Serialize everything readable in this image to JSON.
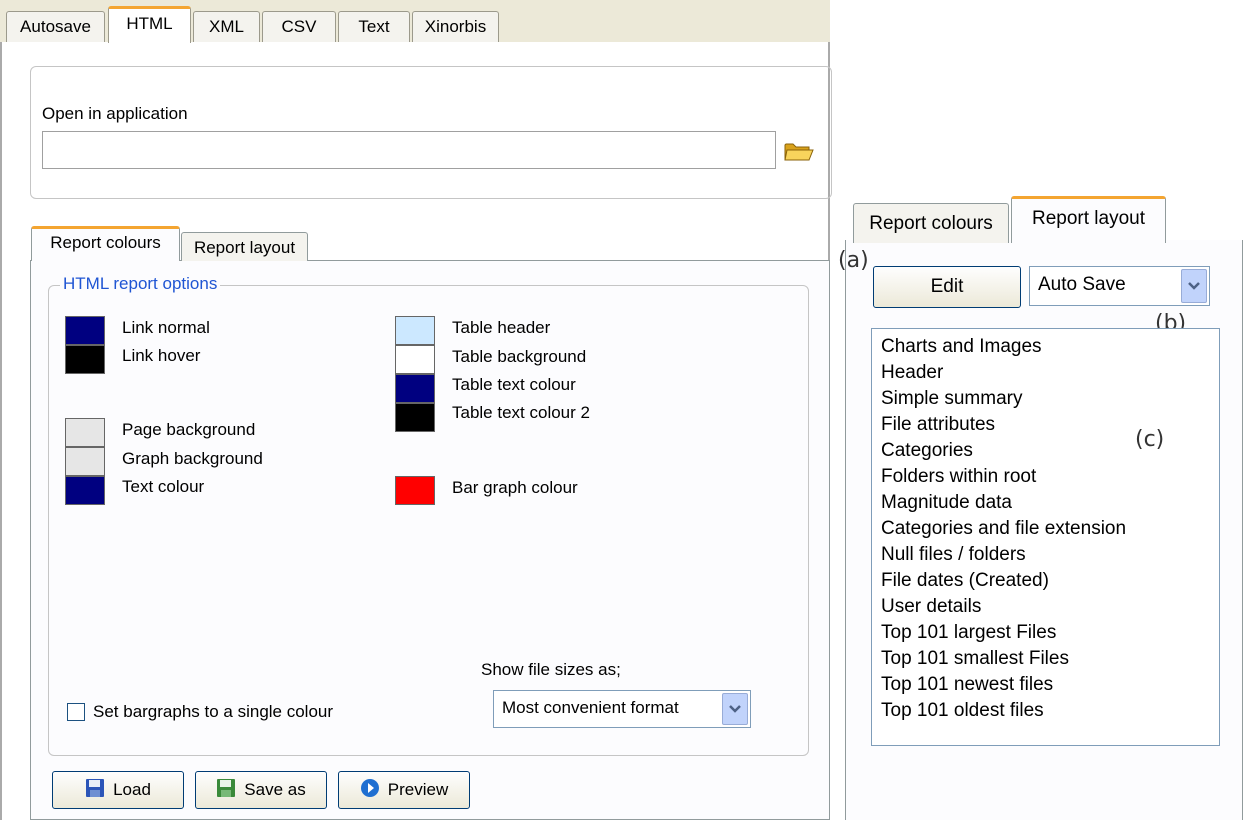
{
  "top_tabs": [
    "Autosave",
    "HTML",
    "XML",
    "CSV",
    "Text",
    "Xinorbis"
  ],
  "open_app": {
    "label": "Open in application",
    "path_value": ""
  },
  "report_tabs": [
    "Report colours",
    "Report layout"
  ],
  "options": {
    "legend": "HTML report options",
    "swatches_left": [
      {
        "label": "Link normal",
        "color": "#000080"
      },
      {
        "label": "Link hover",
        "color": "#000000"
      },
      {
        "label": "Page background",
        "color": "#e6e6e6"
      },
      {
        "label": "Graph background",
        "color": "#e6e6e6"
      },
      {
        "label": "Text colour",
        "color": "#000080"
      }
    ],
    "swatches_right": [
      {
        "label": "Table header",
        "color": "#cce8ff"
      },
      {
        "label": "Table background",
        "color": "#ffffff"
      },
      {
        "label": "Table text colour",
        "color": "#000080"
      },
      {
        "label": "Table text colour 2",
        "color": "#000000"
      },
      {
        "label": "Bar graph colour",
        "color": "#ff0000"
      }
    ],
    "single_colour_checkbox": "Set bargraphs to a single colour",
    "file_sizes_label": "Show file sizes as;",
    "file_sizes_value": "Most convenient format"
  },
  "buttons": {
    "load": "Load",
    "save_as": "Save as",
    "preview": "Preview"
  },
  "layout_panel": {
    "tabs": [
      "Report colours",
      "Report layout"
    ],
    "edit_button": "Edit",
    "dropdown_value": "Auto Save",
    "annotations": {
      "a": "(a)",
      "b": "(b)",
      "c": "(c)"
    },
    "sections": [
      "Charts and Images",
      "Header",
      "Simple summary",
      "File attributes",
      "Categories",
      "Folders within root",
      "Magnitude data",
      "Categories and file extension",
      "Null files / folders",
      "File dates (Created)",
      "User details",
      "Top 101 largest Files",
      "Top 101 smallest Files",
      "Top 101 newest files",
      "Top 101 oldest files"
    ]
  }
}
